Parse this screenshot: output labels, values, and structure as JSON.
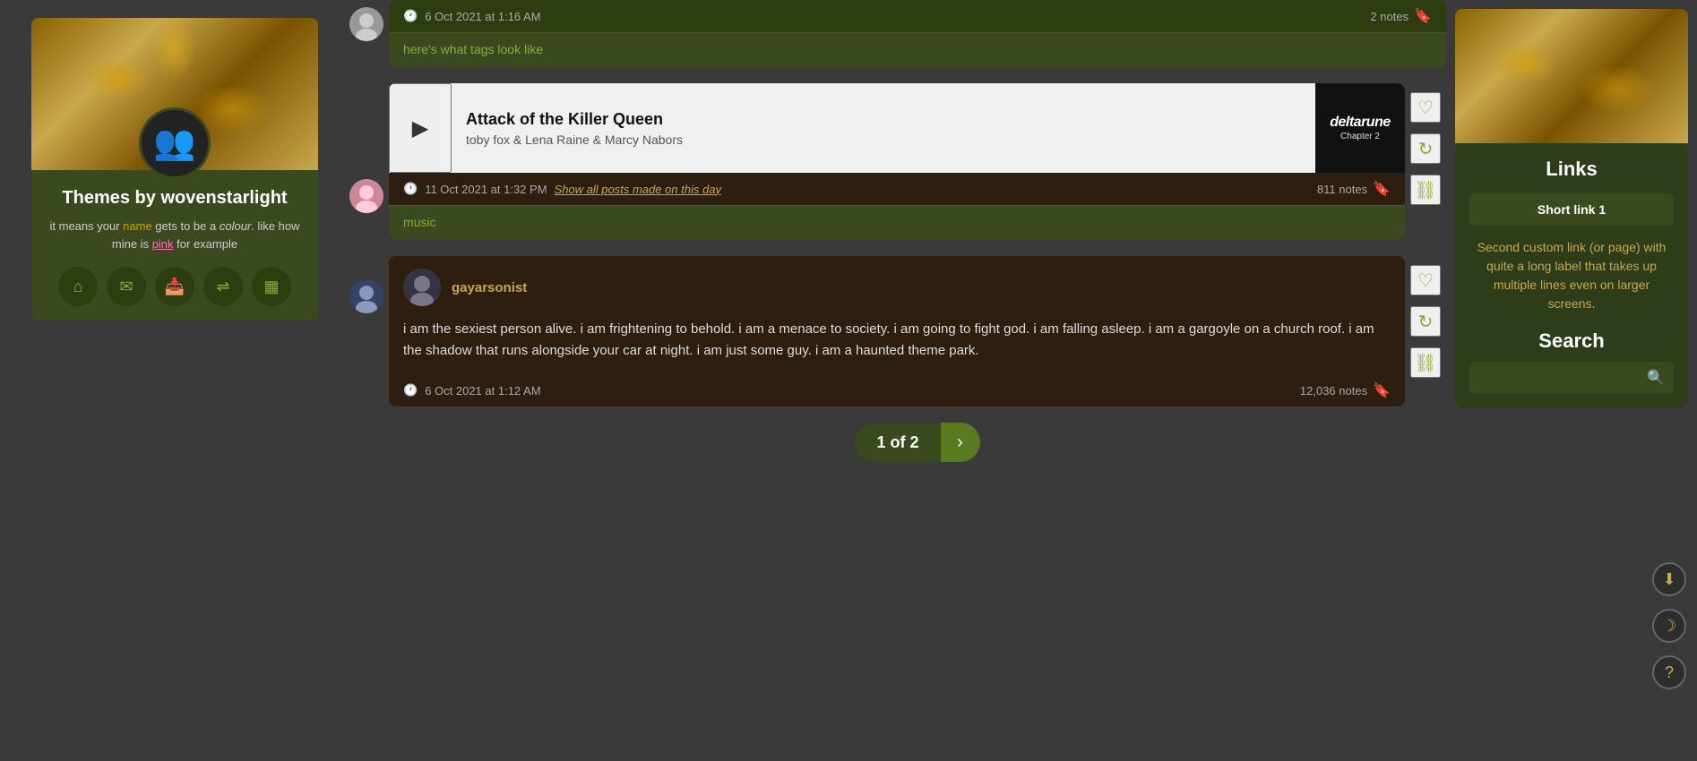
{
  "page": {
    "title": "Themes by wovenstarlight"
  },
  "sidebar": {
    "profile": {
      "name": "Themes by wovenstarlight",
      "description_parts": {
        "before_name": "it means your ",
        "name_word": "name",
        "after_name": " gets to be a ",
        "colour_word": "colour",
        "middle": ". like how mine is ",
        "pink_word": "pink",
        "end": " for example"
      },
      "icons": [
        {
          "name": "home-icon",
          "symbol": "⌂"
        },
        {
          "name": "mail-icon",
          "symbol": "✉"
        },
        {
          "name": "inbox-icon",
          "symbol": "📥"
        },
        {
          "name": "shuffle-icon",
          "symbol": "⇌"
        },
        {
          "name": "archive-icon",
          "symbol": "▦"
        }
      ]
    }
  },
  "feed": {
    "post_partial": {
      "timestamp": "6 Oct 2021 at 1:16 AM",
      "notes": "2 notes",
      "tag": "here's what tags look like"
    },
    "music_post": {
      "song_title": "Attack of the Killer Queen",
      "artist": "toby fox & Lena Raine & Marcy Nabors",
      "album": "deltarune",
      "album_sub": "Chapter 2",
      "timestamp": "11 Oct 2021 at 1:32 PM",
      "show_day_link": "Show all posts made on this day",
      "notes": "811 notes",
      "tag": "music"
    },
    "text_post": {
      "author": "gayarsonist",
      "body": "i am the sexiest person alive. i am frightening to behold. i am a menace to society. i am going to fight god. i am falling asleep. i am a gargoyle on a church roof. i am the shadow that runs alongside your car at night. i am just some guy. i am a haunted theme park.",
      "timestamp": "6 Oct 2021 at 1:12 AM",
      "notes": "12,036 notes"
    },
    "pagination": {
      "label": "1 of 2",
      "next_label": "›"
    }
  },
  "right_sidebar": {
    "links_title": "Links",
    "link1_label": "Short link 1",
    "link2_label": "Second custom link (or page) with quite a long label that takes up multiple lines even on larger screens.",
    "search_title": "Search",
    "search_placeholder": ""
  },
  "edge_icons": [
    {
      "name": "download-icon",
      "symbol": "⬇"
    },
    {
      "name": "moon-icon",
      "symbol": "☽"
    },
    {
      "name": "help-icon",
      "symbol": "?"
    }
  ],
  "actions": {
    "heart": "♡",
    "reblog": "↻",
    "link": "⛓"
  },
  "colors": {
    "accent_green": "#8aad30",
    "accent_gold": "#c9a84c",
    "dark_green": "#2d3d10",
    "post_bg": "#2d1e0f",
    "tag_bg": "#3a4a1e"
  }
}
